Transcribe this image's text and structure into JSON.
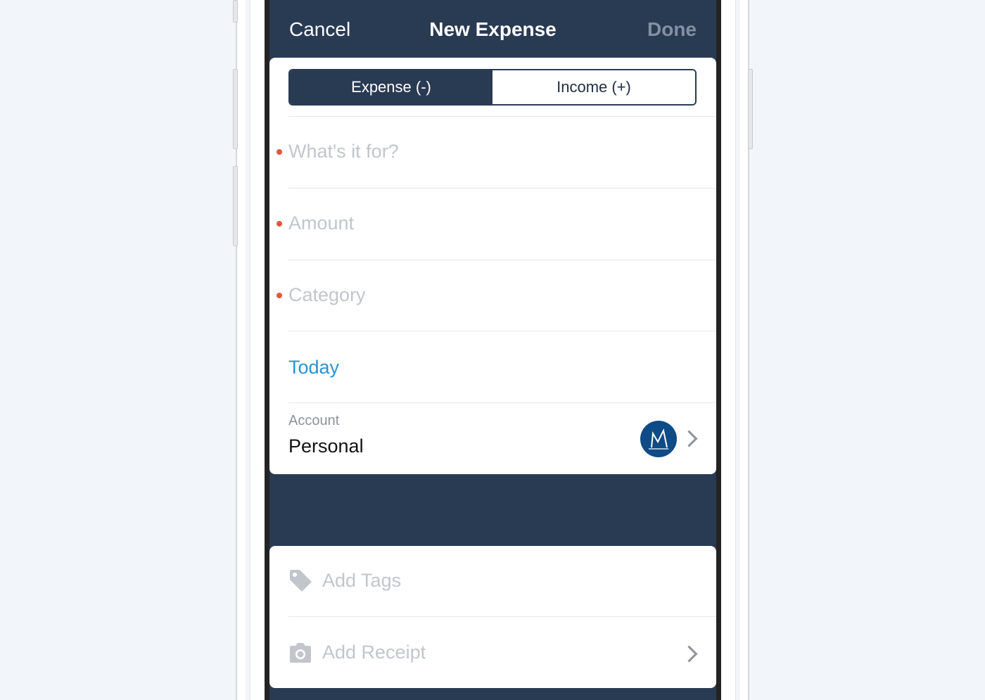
{
  "nav": {
    "cancel_label": "Cancel",
    "title": "New Expense",
    "done_label": "Done"
  },
  "type_toggle": {
    "options": [
      {
        "label": "Expense (-)",
        "selected": true
      },
      {
        "label": "Income (+)",
        "selected": false
      }
    ]
  },
  "fields": {
    "description": {
      "placeholder": "What's it for?",
      "required": true
    },
    "amount": {
      "placeholder": "Amount",
      "required": true
    },
    "category": {
      "placeholder": "Category",
      "required": true
    },
    "date": {
      "value": "Today"
    }
  },
  "account": {
    "label": "Account",
    "value": "Personal",
    "icon": "account-avatar-icon"
  },
  "extras": {
    "tags_label": "Add Tags",
    "tags_icon": "tag-icon",
    "receipt_label": "Add Receipt",
    "receipt_icon": "camera-icon"
  },
  "colors": {
    "nav_background": "#293a53",
    "required_dot": "#e8543f",
    "link_blue": "#2a93d3",
    "placeholder_gray": "#c2c6cc"
  }
}
